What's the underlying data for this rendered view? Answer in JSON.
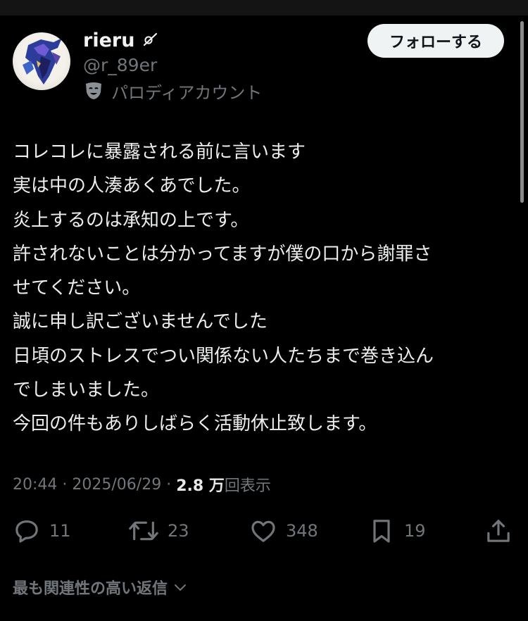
{
  "author": {
    "display_name": "rieru",
    "name_badge_icon": "curl-symbol-icon",
    "handle": "@r_89er",
    "parody_label": "パロディアカウント",
    "parody_icon": "theater-mask-icon"
  },
  "follow_button": {
    "label": "フォローする"
  },
  "post": {
    "lines": [
      "コレコレに暴露される前に言います",
      "実は中の人湊あくあでした。",
      "炎上するのは承知の上です。",
      "許されないことは分かってますが僕の口から謝罪さ",
      "せてください。",
      "誠に申し訳ございませんでした",
      "日頃のストレスでつい関係ない人たちまで巻き込ん",
      "でしまいました。",
      "今回の件もありしばらく活動休止致します。"
    ]
  },
  "meta": {
    "time": "20:44",
    "sep1": " · ",
    "date": "2025/06/29",
    "sep2": " · ",
    "views_count": "2.8 万",
    "views_label": "回表示"
  },
  "actions": {
    "reply_count": "11",
    "repost_count": "23",
    "like_count": "348",
    "bookmark_count": "19"
  },
  "replies": {
    "sort_label": "最も関連性の高い返信"
  },
  "colors": {
    "background": "#000000",
    "text": "#e7e9ea",
    "muted": "#71767b",
    "button_bg": "#eff3f4"
  }
}
